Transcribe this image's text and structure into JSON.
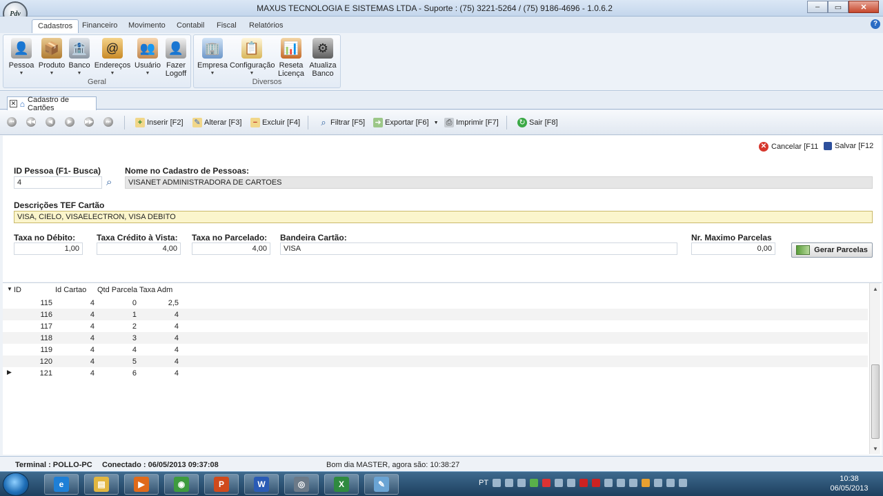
{
  "window": {
    "title": "MAXUS TECNOLOGIA E SISTEMAS LTDA - Suporte : (75) 3221-5264 /  (75) 9186-4696 - 1.0.6.2",
    "logo_text": "Pdv",
    "controls": {
      "minimize": "–",
      "maximize": "▭",
      "close": "✕"
    }
  },
  "menu": {
    "tabs": [
      "Cadastros",
      "Financeiro",
      "Movimento",
      "Contabil",
      "Fiscal",
      "Relatórios"
    ],
    "help": "?"
  },
  "ribbon": {
    "groups": [
      {
        "label": "Geral",
        "buttons": [
          {
            "label": "Pessoa",
            "icon": "person-icon",
            "dropdown": true
          },
          {
            "label": "Produto",
            "icon": "box-icon",
            "dropdown": true
          },
          {
            "label": "Banco",
            "icon": "bank-icon",
            "dropdown": true
          },
          {
            "label": "Endereços",
            "icon": "address-book-icon",
            "dropdown": true
          },
          {
            "label": "Usuário",
            "icon": "users-icon",
            "dropdown": true
          },
          {
            "label": "Fazer",
            "label2": "Logoff",
            "icon": "logoff-icon",
            "dropdown": false
          }
        ]
      },
      {
        "label": "Diversos",
        "buttons": [
          {
            "label": "Empresa",
            "icon": "company-icon",
            "dropdown": true
          },
          {
            "label": "Configuração",
            "icon": "config-icon",
            "dropdown": true
          },
          {
            "label": "Reseta",
            "label2": "Licença",
            "icon": "license-icon",
            "dropdown": false
          },
          {
            "label": "Atualiza",
            "label2": "Banco",
            "icon": "db-update-icon",
            "dropdown": false
          }
        ]
      }
    ]
  },
  "document_tab": {
    "label": "Cadastro de Cartões",
    "close": "✕"
  },
  "toolbar": {
    "nav": [
      "⏮",
      "◀◀",
      "◀",
      "▶",
      "▶▶",
      "⏭"
    ],
    "insert": "Inserir [F2]",
    "alter": "Alterar [F3]",
    "delete": "Excluir [F4]",
    "filter": "Filtrar [F5]",
    "export": "Exportar [F6]",
    "print": "Imprimir [F7]",
    "exit": "Sair [F8]"
  },
  "form": {
    "cancel": "Cancelar [F11",
    "save": "Salvar [F12",
    "id_pessoa_label": "ID Pessoa  (F1- Busca)",
    "id_pessoa_value": "4",
    "nome_label": "Nome no Cadastro de Pessoas:",
    "nome_value": "VISANET ADMINISTRADORA DE CARTOES",
    "descricoes_label": "Descrições TEF  Cartão",
    "descricoes_value": "VISA, CIELO, VISAELECTRON, VISA DEBITO",
    "taxa_debito_label": "Taxa no Débito:",
    "taxa_debito_value": "1,00",
    "taxa_credito_label": "Taxa Crédito à Vista:",
    "taxa_credito_value": "4,00",
    "taxa_parcelado_label": "Taxa no Parcelado:",
    "taxa_parcelado_value": "4,00",
    "bandeira_label": "Bandeira Cartão:",
    "bandeira_value": "VISA",
    "max_parcelas_label": "Nr. Maximo Parcelas",
    "max_parcelas_value": "0,00",
    "gerar_button": "Gerar Parcelas"
  },
  "grid": {
    "columns": [
      "ID",
      "Id Cartao",
      "Qtd Parcela",
      "Taxa Adm"
    ],
    "rows": [
      [
        "115",
        "4",
        "0",
        "2,5"
      ],
      [
        "116",
        "4",
        "1",
        "4"
      ],
      [
        "117",
        "4",
        "2",
        "4"
      ],
      [
        "118",
        "4",
        "3",
        "4"
      ],
      [
        "119",
        "4",
        "4",
        "4"
      ],
      [
        "120",
        "4",
        "5",
        "4"
      ],
      [
        "121",
        "4",
        "6",
        "4"
      ]
    ],
    "current_row_index": 6
  },
  "status": {
    "terminal": "Terminal : POLLO-PC",
    "connected": "Conectado : 06/05/2013 09:37:08",
    "greeting": "Bom dia MASTER,  agora são: 10:38:27"
  },
  "taskbar": {
    "apps": [
      "ie-icon",
      "explorer-icon",
      "media-player-icon",
      "chrome-icon",
      "powerpoint-icon",
      "word-icon",
      "pdv-icon",
      "excel-icon",
      "notepad-icon"
    ],
    "language": "PT",
    "time": "10:38",
    "date": "06/05/2013"
  },
  "colors": {
    "accent": "#2b6cc4",
    "highlight_field": "#fbf5cc",
    "readonly_field": "#e6e6e6"
  }
}
